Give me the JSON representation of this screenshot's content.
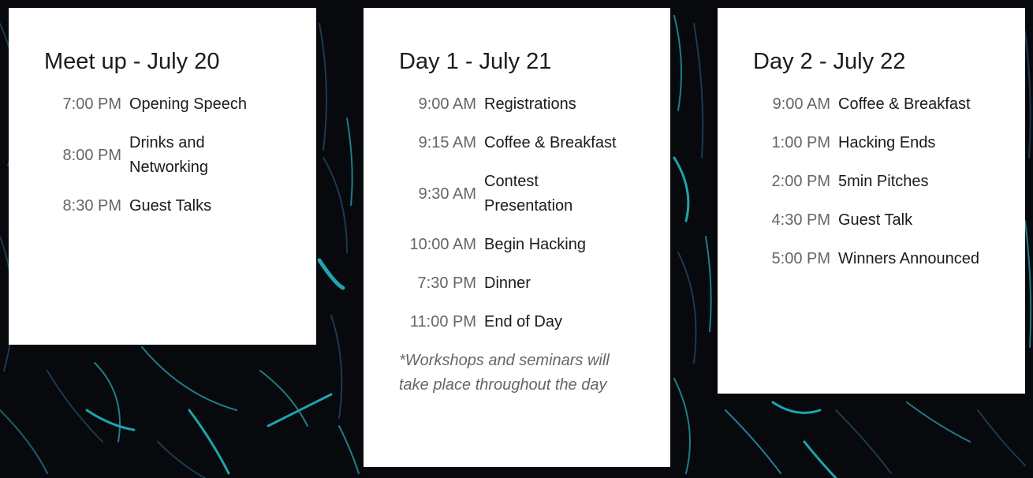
{
  "schedule": [
    {
      "title": "Meet up - July 20",
      "items": [
        {
          "time": "7:00 PM",
          "event": "Opening Speech"
        },
        {
          "time": "8:00 PM",
          "event": "Drinks and Networking"
        },
        {
          "time": "8:30 PM",
          "event": "Guest Talks"
        }
      ],
      "note": ""
    },
    {
      "title": "Day 1 - July 21",
      "items": [
        {
          "time": "9:00 AM",
          "event": "Registrations"
        },
        {
          "time": "9:15 AM",
          "event": "Coffee & Breakfast"
        },
        {
          "time": "9:30 AM",
          "event": "Contest Presentation"
        },
        {
          "time": "10:00 AM",
          "event": "Begin Hacking"
        },
        {
          "time": "7:30 PM",
          "event": "Dinner"
        },
        {
          "time": "11:00 PM",
          "event": "End of Day"
        }
      ],
      "note": "*Workshops and seminars will take place throughout the day"
    },
    {
      "title": "Day 2 - July 22",
      "items": [
        {
          "time": "9:00 AM",
          "event": "Coffee & Breakfast"
        },
        {
          "time": "1:00 PM",
          "event": "Hacking Ends"
        },
        {
          "time": "2:00 PM",
          "event": "5min Pitches"
        },
        {
          "time": "4:30 PM",
          "event": "Guest Talk"
        },
        {
          "time": "5:00 PM",
          "event": "Winners Announced"
        }
      ],
      "note": ""
    }
  ],
  "colors": {
    "background": "#07090c",
    "card": "#ffffff",
    "accent_lines": "#1ca6b0",
    "title_text": "#1b1b1b",
    "time_text": "#666666"
  }
}
